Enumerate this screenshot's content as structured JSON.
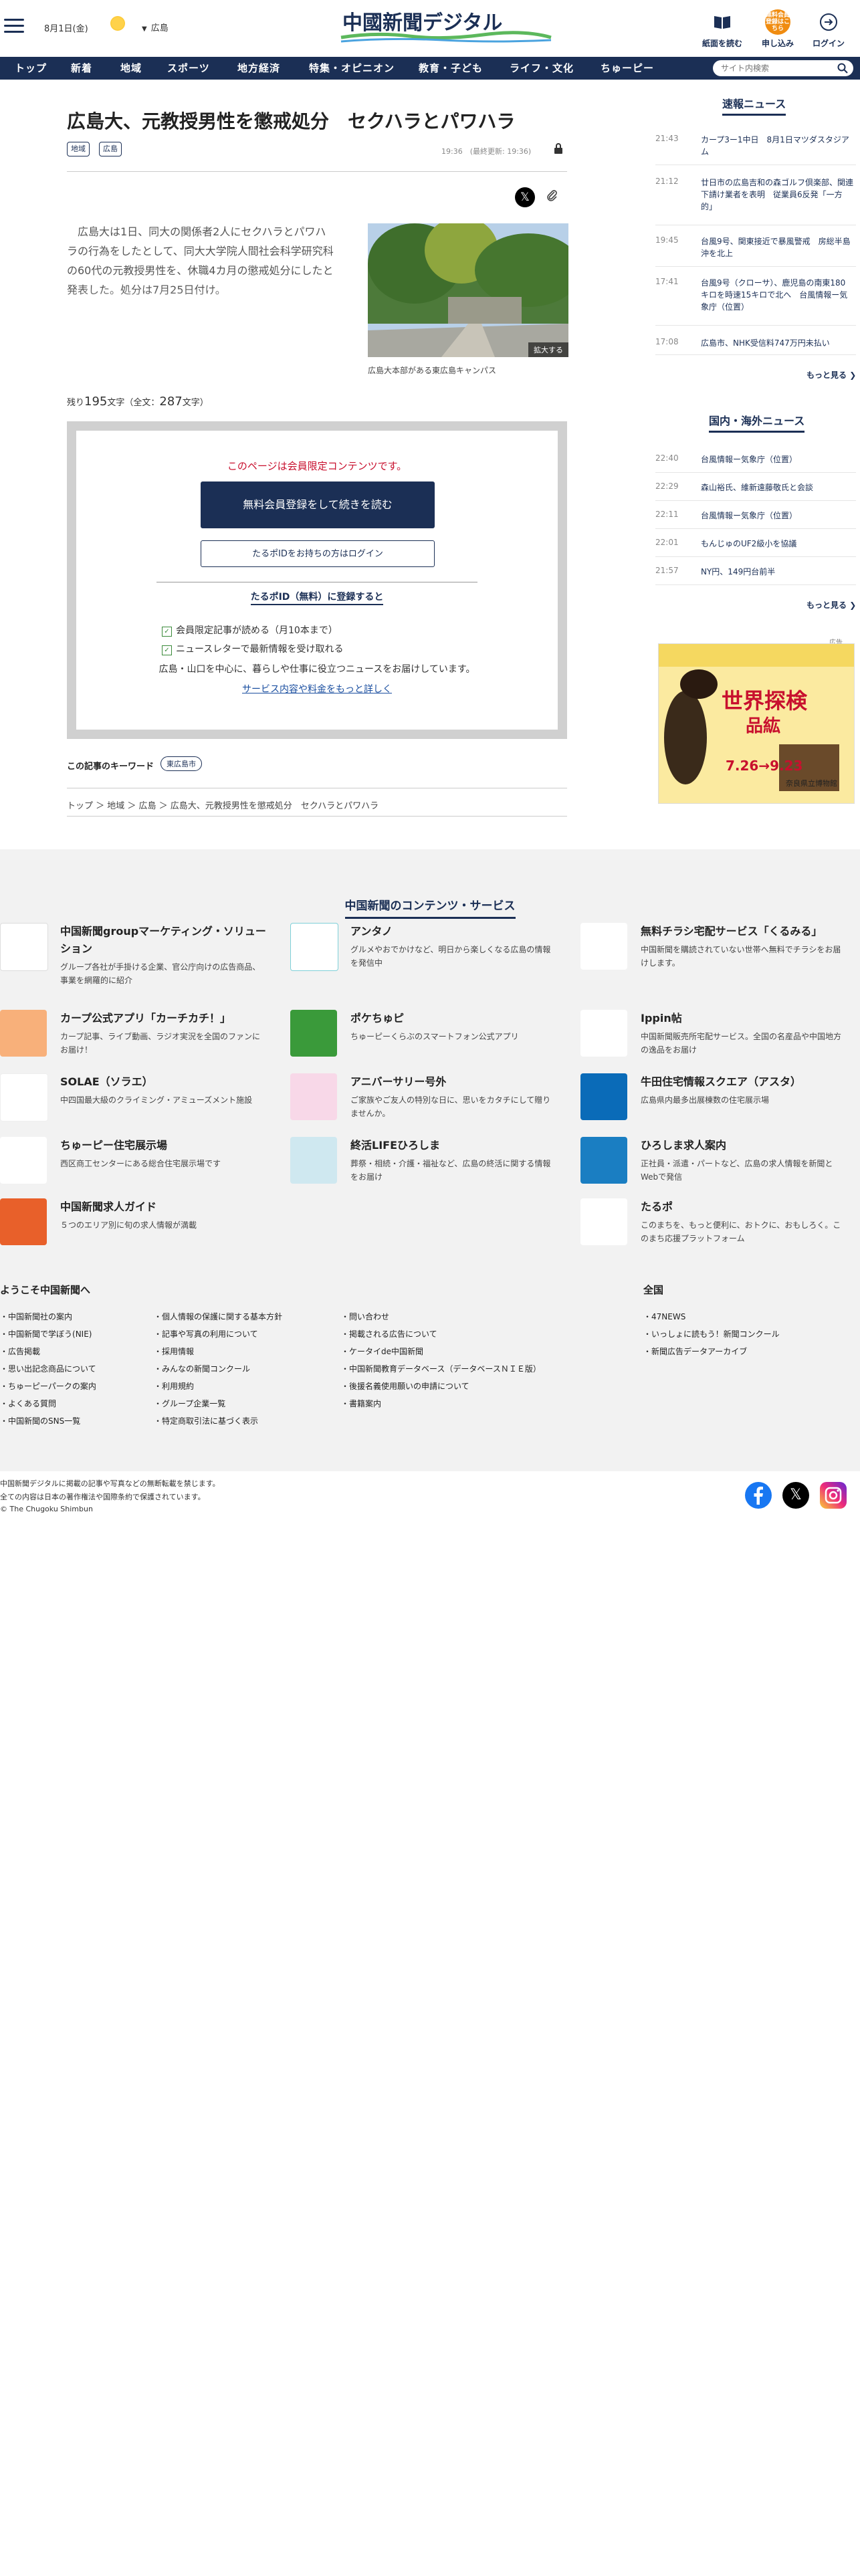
{
  "header": {
    "date": "8月1日(金)",
    "region": "広島",
    "logo": "中國新聞デジタル",
    "paper_label": "紙面を読む",
    "apply_label": "申し込み",
    "apply_badge": "無料会員登録はこちら",
    "login_label": "ログイン"
  },
  "nav": {
    "items": [
      "トップ",
      "新着",
      "地域",
      "スポーツ",
      "地方経済",
      "特集・オピニオン",
      "教育・子ども",
      "ライフ・文化",
      "ちゅーピー"
    ],
    "search_placeholder": "サイト内検索"
  },
  "article": {
    "title": "広島大、元教授男性を懲戒処分　セクハラとパワハラ",
    "tags": [
      "地域",
      "広島"
    ],
    "time": "19:36　(最終更新: 19:36)",
    "lead": "　広島大は1日、同大の関係者2人にセクハラとパワハラの行為をしたとして、同大大学院人間社会科学研究科の60代の元教授男性を、休職4カ月の懲戒処分にしたと発表した。処分は7月25日付け。",
    "photo_caption": "広島大本部がある東広島キャンパス",
    "enlarge": "拡大する",
    "remaining_prefix": "残り",
    "remaining_count": "195",
    "remaining_mid": "文字（全文：",
    "total_count": "287",
    "remaining_suffix": "文字）",
    "keyword_label": "この記事のキーワード",
    "keyword": "東広島市",
    "breadcrumb": "トップ ＞ 地域 ＞ 広島 ＞ 広島大、元教授男性を懲戒処分　セクハラとパワハラ"
  },
  "paywall": {
    "notice": "このページは会員限定コンテンツです。",
    "register_btn": "無料会員登録をして続きを読む",
    "login_btn": "たるポIDをお持ちの方はログイン",
    "heading": "たるポID（無料）に登録すると",
    "benefits": [
      "会員限定記事が読める（月10本まで）",
      "ニュースレターで最新情報を受け取れる"
    ],
    "note": "広島・山口を中心に、暮らしや仕事に役立つニュースをお届けしています。",
    "more_link": "サービス内容や料金をもっと詳しく"
  },
  "sidebar": {
    "breaking_title": "速報ニュース",
    "breaking": [
      {
        "time": "21:43",
        "title": "カープ3ー1中日　8月1日マツダスタジアム"
      },
      {
        "time": "21:12",
        "title": "廿日市の広島吉和の森ゴルフ倶楽部、関連下請け業者を表明　従業員6反発「一方的」"
      },
      {
        "time": "19:45",
        "title": "台風9号、関東接近で暴風警戒　房総半島沖を北上"
      },
      {
        "time": "17:41",
        "title": "台風9号（クローサ）、鹿児島の南東180キロを時速15キロで北へ　台風情報ー気象庁（位置）"
      },
      {
        "time": "17:08",
        "title": "広島市、NHK受信料747万円未払い"
      }
    ],
    "more": "もっと見る",
    "intl_title": "国内・海外ニュース",
    "intl": [
      {
        "time": "22:40",
        "title": "台風情報ー気象庁（位置）"
      },
      {
        "time": "22:29",
        "title": "森山裕氏、維新遠藤敬氏と会談"
      },
      {
        "time": "22:11",
        "title": "台風情報ー気象庁（位置）"
      },
      {
        "time": "22:01",
        "title": "もんじゅのUF2級小を協議"
      },
      {
        "time": "21:57",
        "title": "NY円、149円台前半"
      }
    ],
    "ad_label": "広告",
    "ad_title": "世界探検",
    "ad_sub": "品紘",
    "ad_date": "7.26→9.23",
    "ad_venue": "奈良県立博物館"
  },
  "services": {
    "title": "中国新聞のコンテンツ・サービス",
    "items": [
      {
        "name": "中国新聞groupマーケティング・ソリューション",
        "desc": "グループ各社が手掛ける企業、官公庁向けの広告商品、事業を網羅的に紹介",
        "color": "#ffffff",
        "icon": "marketing-logo"
      },
      {
        "name": "アンタノ",
        "desc": "グルメやおでかけなど、明日から楽しくなる広島の情報を発信中",
        "color": "#ffffff",
        "icon": "antano-logo"
      },
      {
        "name": "無料チラシ宅配サービス「くるみる」",
        "desc": "中国新聞を購読されていない世帯へ無料でチラシをお届けします。",
        "color": "#ffffff",
        "icon": "kurumiru-logo"
      },
      {
        "name": "カープ公式アプリ「カーチカチ！」",
        "desc": "カープ記事、ライブ動画、ラジオ実況を全国のファンにお届け！",
        "color": "#f8b07a",
        "icon": "carp-logo"
      },
      {
        "name": "ポケちゅピ",
        "desc": "ちゅーピーくらぶのスマートフォン公式アプリ",
        "color": "#3a9a3a",
        "icon": "pokechupi-logo"
      },
      {
        "name": "Ippin帖",
        "desc": "中国新聞販売所宅配サービス。全国の名産品や中国地方の逸品をお届け",
        "color": "#ffffff",
        "icon": "ippin-logo"
      },
      {
        "name": "SOLAE（ソラエ）",
        "desc": "中四国最大級のクライミング・アミューズメント施設",
        "color": "#ffffff",
        "icon": "solae-logo"
      },
      {
        "name": "アニバーサリー号外",
        "desc": "ご家族やご友人の特別な日に、思いをカタチにして贈りませんか。",
        "color": "#f8d8e8",
        "icon": "anniversary-logo"
      },
      {
        "name": "牛田住宅情報スクエア（アスタ）",
        "desc": "広島県内最多出展棟数の住宅展示場",
        "color": "#0a6bb8",
        "icon": "asta-logo"
      },
      {
        "name": "ちゅーピー住宅展示場",
        "desc": "西区商工センターにある総合住宅展示場です",
        "color": "#ffffff",
        "icon": "chupi-house-logo"
      },
      {
        "name": "終活LIFEひろしま",
        "desc": "葬祭・相続・介護・福祉など、広島の終活に関する情報をお届け",
        "color": "#cfe8f0",
        "icon": "shukatsu-logo"
      },
      {
        "name": "ひろしま求人案内",
        "desc": "正社員・派遣・パートなど、広島の求人情報を新聞とWebで発信",
        "color": "#1a7ec2",
        "icon": "kyujin-logo"
      },
      {
        "name": "中国新聞求人ガイド",
        "desc": "５つのエリア別に旬の求人情報が満載",
        "color": "#e8602a",
        "icon": "kyujin-guide-logo"
      },
      {
        "name": "たるポ",
        "desc": "このまちを、もっと便利に、おトクに、おもしろく。このまち応援プラットフォーム",
        "color": "#ffffff",
        "icon": "taruPo-logo"
      }
    ]
  },
  "footer": {
    "welcome": "ようこそ中国新聞へ",
    "col1": [
      "中国新聞社の案内",
      "中国新聞で学ぼう(NIE)",
      "広告掲載",
      "思い出記念商品について",
      "ちゅーピーパークの案内",
      "よくある質問",
      "中国新聞のSNS一覧"
    ],
    "col2": [
      "個人情報の保護に関する基本方針",
      "記事や写真の利用について",
      "採用情報",
      "みんなの新聞コンクール",
      "利用規約",
      "グループ企業一覧",
      "特定商取引法に基づく表示"
    ],
    "col3": [
      "問い合わせ",
      "掲載される広告について",
      "ケータイde中国新聞",
      "中国新聞教育データベース（データベースＮＩＥ版）",
      "後援名義使用願いの申請について",
      "書籍案内"
    ],
    "national": "全国",
    "col4": [
      "47NEWS",
      "いっしょに読もう！新聞コンクール",
      "新聞広告データアーカイブ"
    ],
    "copy1": "中国新聞デジタルに掲載の記事や写真などの無断転載を禁じます。",
    "copy2": "全ての内容は日本の著作権法や国際条約で保護されています。",
    "copy3": "© The Chugoku Shimbun"
  }
}
